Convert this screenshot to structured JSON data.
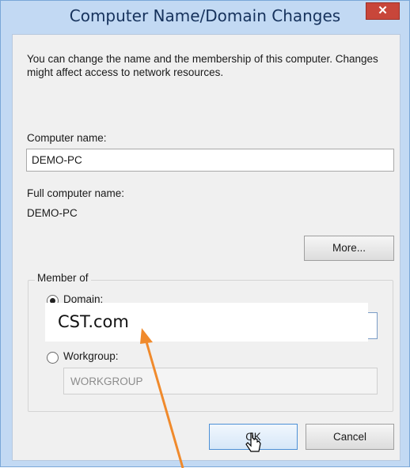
{
  "window": {
    "title": "Computer Name/Domain Changes",
    "close_label": "✕"
  },
  "intro_text": "You can change the name and the membership of this computer. Changes might affect access to network resources.",
  "computer_name": {
    "label": "Computer name:",
    "value": "DEMO-PC"
  },
  "full_computer_name": {
    "label": "Full computer name:",
    "value": "DEMO-PC"
  },
  "buttons": {
    "more": "More...",
    "ok": "OK",
    "cancel": "Cancel"
  },
  "member_of": {
    "legend": "Member of",
    "domain_label": "Domain:",
    "domain_selected": true,
    "domain_value": "CST.com",
    "workgroup_label": "Workgroup:",
    "workgroup_selected": false,
    "workgroup_value": "WORKGROUP"
  },
  "colors": {
    "frame": "#c2d9f3",
    "title_text": "#16325c",
    "close_button": "#c8463a",
    "annotation_arrow": "#f08a2c"
  }
}
